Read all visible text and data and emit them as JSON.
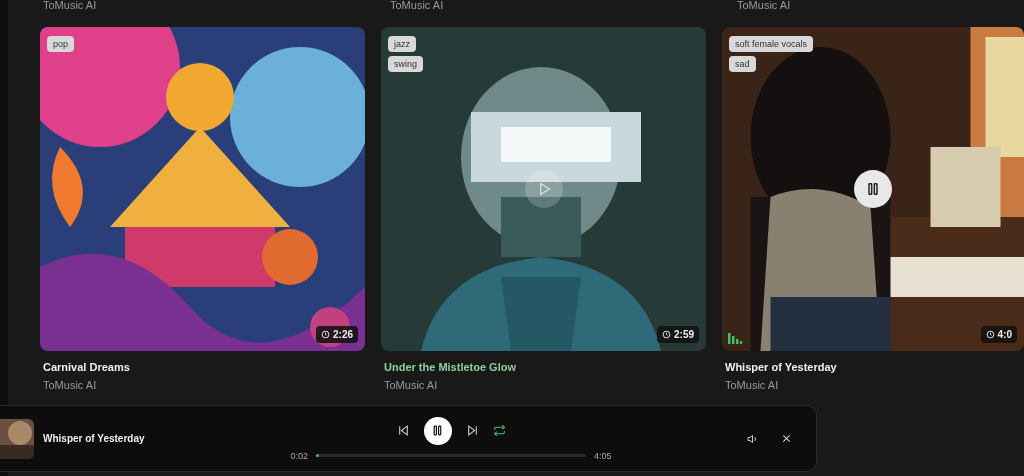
{
  "previous_row": [
    {
      "artist": "ToMusic AI"
    },
    {
      "artist": "ToMusic AI"
    },
    {
      "artist": "ToMusic AI"
    }
  ],
  "songs": [
    {
      "title": "Carnival Dreams",
      "artist": "ToMusic AI",
      "tags": [
        "pop"
      ],
      "duration": "2:26",
      "hovered": false,
      "playing": false
    },
    {
      "title": "Under the Mistletoe Glow",
      "artist": "ToMusic AI",
      "tags": [
        "jazz",
        "swing"
      ],
      "duration": "2:59",
      "hovered": true,
      "playing": false
    },
    {
      "title": "Whisper of Yesterday",
      "artist": "ToMusic AI",
      "tags": [
        "soft female vocals",
        "sad"
      ],
      "duration": "4:0",
      "hovered": false,
      "playing": true
    }
  ],
  "player": {
    "title": "Whisper of Yesterday",
    "playing": true,
    "repeat": true,
    "elapsed": "0:02",
    "total": "4:05",
    "level": 0.01
  }
}
